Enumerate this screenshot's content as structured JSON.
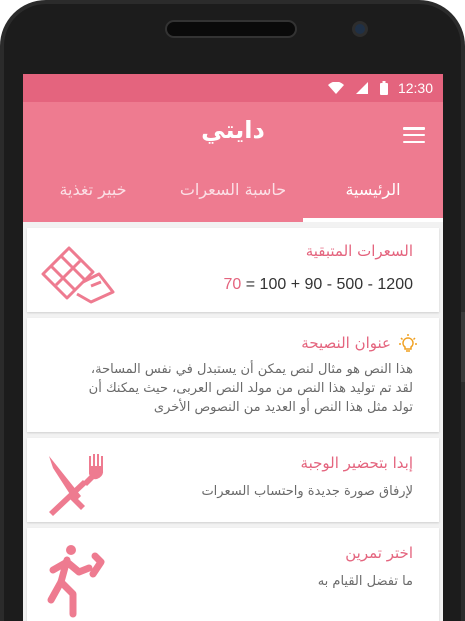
{
  "status_bar": {
    "time": "12:30",
    "icons": [
      "wifi-icon",
      "signal-icon",
      "battery-icon"
    ],
    "color": "#e4647e"
  },
  "app": {
    "title": "دايتي",
    "menu_icon": "menu-icon",
    "accent": "#ee7b90"
  },
  "tabs": [
    {
      "label": "الرئيسية",
      "active": true
    },
    {
      "label": "حاسبة السعرات",
      "active": false
    },
    {
      "label": "خبير تغذية",
      "active": false
    }
  ],
  "cards": {
    "calories": {
      "title": "السعرات المتبقية",
      "result": "70",
      "equation": " = 100 + 90 - 500 - 1200",
      "icon": "chocolate-bar-icon"
    },
    "tip": {
      "title": "عنوان النصيحة",
      "icon": "lightbulb-icon",
      "lines": [
        "هذا النص هو مثال لنص يمكن أن يستبدل في نفس المساحة،",
        "لقد تم توليد هذا النص من مولد النص العربى، حيث يمكنك أن",
        "تولد مثل هذا النص أو العديد من النصوص الأخرى"
      ]
    },
    "meal": {
      "title": "إبدا بتحضير الوجبة",
      "text": "لإرفاق صورة جديدة واحتساب السعرات",
      "icon": "fork-knife-icon"
    },
    "exercise": {
      "title": "اختر تمرين",
      "text": "ما تفضل القيام به",
      "icon": "running-person-icon"
    }
  }
}
